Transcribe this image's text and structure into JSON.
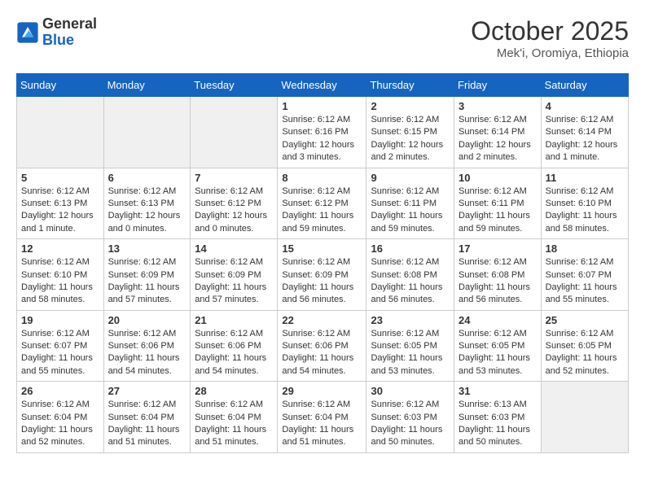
{
  "logo": {
    "general": "General",
    "blue": "Blue"
  },
  "title": "October 2025",
  "location": "Mek'i, Oromiya, Ethiopia",
  "weekdays": [
    "Sunday",
    "Monday",
    "Tuesday",
    "Wednesday",
    "Thursday",
    "Friday",
    "Saturday"
  ],
  "weeks": [
    [
      {
        "day": "",
        "info": ""
      },
      {
        "day": "",
        "info": ""
      },
      {
        "day": "",
        "info": ""
      },
      {
        "day": "1",
        "info": "Sunrise: 6:12 AM\nSunset: 6:16 PM\nDaylight: 12 hours and 3 minutes."
      },
      {
        "day": "2",
        "info": "Sunrise: 6:12 AM\nSunset: 6:15 PM\nDaylight: 12 hours and 2 minutes."
      },
      {
        "day": "3",
        "info": "Sunrise: 6:12 AM\nSunset: 6:14 PM\nDaylight: 12 hours and 2 minutes."
      },
      {
        "day": "4",
        "info": "Sunrise: 6:12 AM\nSunset: 6:14 PM\nDaylight: 12 hours and 1 minute."
      }
    ],
    [
      {
        "day": "5",
        "info": "Sunrise: 6:12 AM\nSunset: 6:13 PM\nDaylight: 12 hours and 1 minute."
      },
      {
        "day": "6",
        "info": "Sunrise: 6:12 AM\nSunset: 6:13 PM\nDaylight: 12 hours and 0 minutes."
      },
      {
        "day": "7",
        "info": "Sunrise: 6:12 AM\nSunset: 6:12 PM\nDaylight: 12 hours and 0 minutes."
      },
      {
        "day": "8",
        "info": "Sunrise: 6:12 AM\nSunset: 6:12 PM\nDaylight: 11 hours and 59 minutes."
      },
      {
        "day": "9",
        "info": "Sunrise: 6:12 AM\nSunset: 6:11 PM\nDaylight: 11 hours and 59 minutes."
      },
      {
        "day": "10",
        "info": "Sunrise: 6:12 AM\nSunset: 6:11 PM\nDaylight: 11 hours and 59 minutes."
      },
      {
        "day": "11",
        "info": "Sunrise: 6:12 AM\nSunset: 6:10 PM\nDaylight: 11 hours and 58 minutes."
      }
    ],
    [
      {
        "day": "12",
        "info": "Sunrise: 6:12 AM\nSunset: 6:10 PM\nDaylight: 11 hours and 58 minutes."
      },
      {
        "day": "13",
        "info": "Sunrise: 6:12 AM\nSunset: 6:09 PM\nDaylight: 11 hours and 57 minutes."
      },
      {
        "day": "14",
        "info": "Sunrise: 6:12 AM\nSunset: 6:09 PM\nDaylight: 11 hours and 57 minutes."
      },
      {
        "day": "15",
        "info": "Sunrise: 6:12 AM\nSunset: 6:09 PM\nDaylight: 11 hours and 56 minutes."
      },
      {
        "day": "16",
        "info": "Sunrise: 6:12 AM\nSunset: 6:08 PM\nDaylight: 11 hours and 56 minutes."
      },
      {
        "day": "17",
        "info": "Sunrise: 6:12 AM\nSunset: 6:08 PM\nDaylight: 11 hours and 56 minutes."
      },
      {
        "day": "18",
        "info": "Sunrise: 6:12 AM\nSunset: 6:07 PM\nDaylight: 11 hours and 55 minutes."
      }
    ],
    [
      {
        "day": "19",
        "info": "Sunrise: 6:12 AM\nSunset: 6:07 PM\nDaylight: 11 hours and 55 minutes."
      },
      {
        "day": "20",
        "info": "Sunrise: 6:12 AM\nSunset: 6:06 PM\nDaylight: 11 hours and 54 minutes."
      },
      {
        "day": "21",
        "info": "Sunrise: 6:12 AM\nSunset: 6:06 PM\nDaylight: 11 hours and 54 minutes."
      },
      {
        "day": "22",
        "info": "Sunrise: 6:12 AM\nSunset: 6:06 PM\nDaylight: 11 hours and 54 minutes."
      },
      {
        "day": "23",
        "info": "Sunrise: 6:12 AM\nSunset: 6:05 PM\nDaylight: 11 hours and 53 minutes."
      },
      {
        "day": "24",
        "info": "Sunrise: 6:12 AM\nSunset: 6:05 PM\nDaylight: 11 hours and 53 minutes."
      },
      {
        "day": "25",
        "info": "Sunrise: 6:12 AM\nSunset: 6:05 PM\nDaylight: 11 hours and 52 minutes."
      }
    ],
    [
      {
        "day": "26",
        "info": "Sunrise: 6:12 AM\nSunset: 6:04 PM\nDaylight: 11 hours and 52 minutes."
      },
      {
        "day": "27",
        "info": "Sunrise: 6:12 AM\nSunset: 6:04 PM\nDaylight: 11 hours and 51 minutes."
      },
      {
        "day": "28",
        "info": "Sunrise: 6:12 AM\nSunset: 6:04 PM\nDaylight: 11 hours and 51 minutes."
      },
      {
        "day": "29",
        "info": "Sunrise: 6:12 AM\nSunset: 6:04 PM\nDaylight: 11 hours and 51 minutes."
      },
      {
        "day": "30",
        "info": "Sunrise: 6:12 AM\nSunset: 6:03 PM\nDaylight: 11 hours and 50 minutes."
      },
      {
        "day": "31",
        "info": "Sunrise: 6:13 AM\nSunset: 6:03 PM\nDaylight: 11 hours and 50 minutes."
      },
      {
        "day": "",
        "info": ""
      }
    ]
  ]
}
